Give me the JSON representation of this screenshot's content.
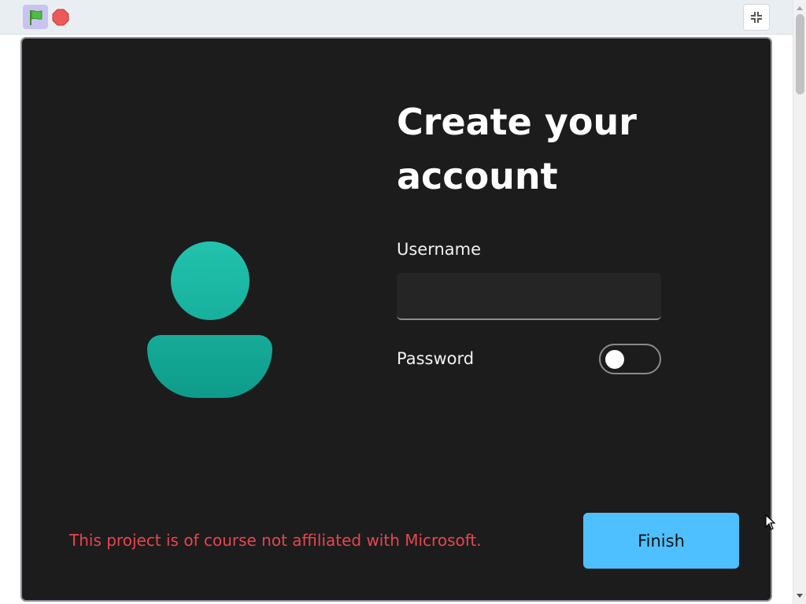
{
  "toolbar": {
    "green_flag_icon": "green-flag-icon",
    "stop_icon": "stop-icon",
    "fullscreen_exit_icon": "fullscreen-exit-icon"
  },
  "stage": {
    "title": "Create your account",
    "username_label": "Username",
    "username_value": "",
    "password_label": "Password",
    "password_toggle_on": false,
    "disclaimer": "This project is of course not affiliated with Microsoft.",
    "finish_label": "Finish",
    "avatar_icon": "person-icon"
  },
  "colors": {
    "stage_background": "#1c1c1d",
    "accent_teal": "#17b09c",
    "finish_button": "#4fc0ff",
    "disclaimer_text": "#e8454e",
    "flag_button_highlight": "#c9c4ef"
  }
}
